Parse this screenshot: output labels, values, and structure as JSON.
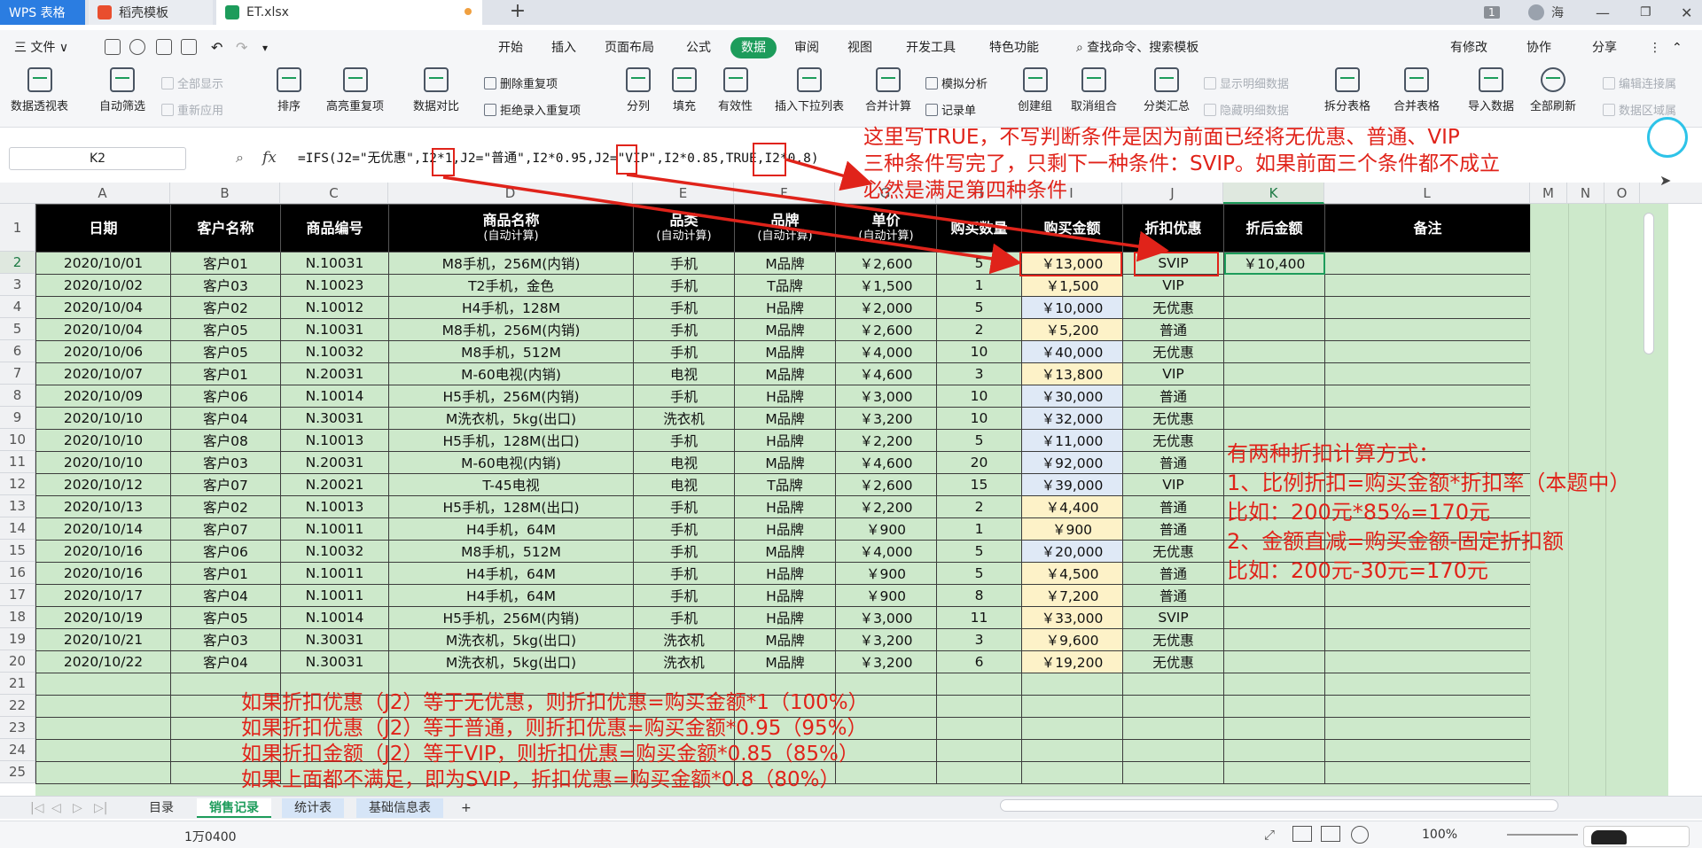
{
  "titlebar": {
    "tabs": [
      {
        "label": "WPS 表格"
      },
      {
        "label": "稻壳模板"
      },
      {
        "label": "ET.xlsx"
      }
    ],
    "plus": "+",
    "window_badge": "1",
    "user": "海"
  },
  "menubar": {
    "file": "三 文件 ∨",
    "items": [
      "开始",
      "插入",
      "页面布局",
      "公式",
      "数据",
      "审阅",
      "视图",
      "开发工具",
      "特色功能"
    ],
    "search": "查找命令、搜索模板",
    "right": [
      "有修改",
      "协作",
      "分享"
    ]
  },
  "ribbon": {
    "big": [
      "数据透视表",
      "自动筛选",
      "排序",
      "高亮重复项",
      "数据对比",
      "分列",
      "填充",
      "有效性",
      "插入下拉列表",
      "合并计算",
      "创建组",
      "取消组合",
      "分类汇总",
      "拆分表格",
      "合并表格",
      "导入数据",
      "全部刷新"
    ],
    "small": {
      "show_all": "全部显示",
      "reapply": "重新应用",
      "delete_dup": "删除重复项",
      "reject_dup": "拒绝录入重复项",
      "simulate": "模拟分析",
      "record": "记录单",
      "show_detail": "显示明细数据",
      "hide_detail": "隐藏明细数据",
      "edit_links": "编辑连接属",
      "data_range": "数据区域属"
    }
  },
  "formulabar": {
    "cell": "K2",
    "fx": "fx",
    "formula": "=IFS(J2=\"无优惠\",I2*1,J2=\"普通\",I2*0.95,J2=\"VIP\",I2*0.85,TRUE,I2*0.8)"
  },
  "columns": [
    "A",
    "B",
    "C",
    "D",
    "E",
    "F",
    "G",
    "H",
    "I",
    "J",
    "K",
    "L",
    "M",
    "N",
    "O"
  ],
  "rows": [
    "1",
    "2",
    "3",
    "4",
    "5",
    "6",
    "7",
    "8",
    "9",
    "10",
    "11",
    "12",
    "13",
    "14",
    "15",
    "16",
    "17",
    "18",
    "19",
    "20",
    "21",
    "22",
    "23",
    "24",
    "25"
  ],
  "table": {
    "headers": [
      {
        "main": "日期",
        "sub": ""
      },
      {
        "main": "客户名称",
        "sub": ""
      },
      {
        "main": "商品编号",
        "sub": ""
      },
      {
        "main": "商品名称",
        "sub": "(自动计算)"
      },
      {
        "main": "品类",
        "sub": "(自动计算)"
      },
      {
        "main": "品牌",
        "sub": "(自动计算)"
      },
      {
        "main": "单价",
        "sub": "(自动计算)"
      },
      {
        "main": "购买数量",
        "sub": ""
      },
      {
        "main": "购买金额",
        "sub": ""
      },
      {
        "main": "折扣优惠",
        "sub": ""
      },
      {
        "main": "折后金额",
        "sub": ""
      },
      {
        "main": "备注",
        "sub": ""
      }
    ],
    "rows": [
      [
        "2020/10/01",
        "客户01",
        "N.10031",
        "M8手机，256M(内销)",
        "手机",
        "M品牌",
        "￥2,600",
        "5",
        "￥13,000",
        "SVIP",
        "￥10,400",
        ""
      ],
      [
        "2020/10/02",
        "客户03",
        "N.10023",
        "T2手机，金色",
        "手机",
        "T品牌",
        "￥1,500",
        "1",
        "￥1,500",
        "VIP",
        "",
        ""
      ],
      [
        "2020/10/04",
        "客户02",
        "N.10012",
        "H4手机，128M",
        "手机",
        "H品牌",
        "￥2,000",
        "5",
        "￥10,000",
        "无优惠",
        "",
        ""
      ],
      [
        "2020/10/04",
        "客户05",
        "N.10031",
        "M8手机，256M(内销)",
        "手机",
        "M品牌",
        "￥2,600",
        "2",
        "￥5,200",
        "普通",
        "",
        ""
      ],
      [
        "2020/10/06",
        "客户05",
        "N.10032",
        "M8手机，512M",
        "手机",
        "M品牌",
        "￥4,000",
        "10",
        "￥40,000",
        "无优惠",
        "",
        ""
      ],
      [
        "2020/10/07",
        "客户01",
        "N.20031",
        "M-60电视(内销)",
        "电视",
        "M品牌",
        "￥4,600",
        "3",
        "￥13,800",
        "VIP",
        "",
        ""
      ],
      [
        "2020/10/09",
        "客户06",
        "N.10014",
        "H5手机，256M(内销)",
        "手机",
        "H品牌",
        "￥3,000",
        "10",
        "￥30,000",
        "普通",
        "",
        ""
      ],
      [
        "2020/10/10",
        "客户04",
        "N.30031",
        "M洗衣机，5kg(出口)",
        "洗衣机",
        "M品牌",
        "￥3,200",
        "10",
        "￥32,000",
        "无优惠",
        "",
        ""
      ],
      [
        "2020/10/10",
        "客户08",
        "N.10013",
        "H5手机，128M(出口)",
        "手机",
        "H品牌",
        "￥2,200",
        "5",
        "￥11,000",
        "无优惠",
        "",
        ""
      ],
      [
        "2020/10/10",
        "客户03",
        "N.20031",
        "M-60电视(内销)",
        "电视",
        "M品牌",
        "￥4,600",
        "20",
        "￥92,000",
        "普通",
        "",
        ""
      ],
      [
        "2020/10/12",
        "客户07",
        "N.20021",
        "T-45电视",
        "电视",
        "T品牌",
        "￥2,600",
        "15",
        "￥39,000",
        "VIP",
        "",
        ""
      ],
      [
        "2020/10/13",
        "客户02",
        "N.10013",
        "H5手机，128M(出口)",
        "手机",
        "H品牌",
        "￥2,200",
        "2",
        "￥4,400",
        "普通",
        "",
        ""
      ],
      [
        "2020/10/14",
        "客户07",
        "N.10011",
        "H4手机，64M",
        "手机",
        "H品牌",
        "￥900",
        "1",
        "￥900",
        "普通",
        "",
        ""
      ],
      [
        "2020/10/16",
        "客户06",
        "N.10032",
        "M8手机，512M",
        "手机",
        "M品牌",
        "￥4,000",
        "5",
        "￥20,000",
        "无优惠",
        "",
        ""
      ],
      [
        "2020/10/16",
        "客户01",
        "N.10011",
        "H4手机，64M",
        "手机",
        "H品牌",
        "￥900",
        "5",
        "￥4,500",
        "普通",
        "",
        ""
      ],
      [
        "2020/10/17",
        "客户04",
        "N.10011",
        "H4手机，64M",
        "手机",
        "H品牌",
        "￥900",
        "8",
        "￥7,200",
        "普通",
        "",
        ""
      ],
      [
        "2020/10/19",
        "客户05",
        "N.10014",
        "H5手机，256M(内销)",
        "手机",
        "H品牌",
        "￥3,000",
        "11",
        "￥33,000",
        "SVIP",
        "",
        ""
      ],
      [
        "2020/10/21",
        "客户03",
        "N.30031",
        "M洗衣机，5kg(出口)",
        "洗衣机",
        "M品牌",
        "￥3,200",
        "3",
        "￥9,600",
        "无优惠",
        "",
        ""
      ],
      [
        "2020/10/22",
        "客户04",
        "N.30031",
        "M洗衣机，5kg(出口)",
        "洗衣机",
        "M品牌",
        "￥3,200",
        "6",
        "￥19,200",
        "无优惠",
        "",
        ""
      ]
    ]
  },
  "notes": {
    "top": [
      "这里写TRUE，不写判断条件是因为前面已经将无优惠、普通、VIP",
      "三种条件写完了，只剩下一种条件：SVIP。如果前面三个条件都不成立",
      "必然是满足第四种条件"
    ],
    "right": [
      "有两种折扣计算方式：",
      "1、比例折扣=购买金额*折扣率（本题中）",
      "比如：200元*85%=170元",
      "2、金额直减=购买金额-固定折扣额",
      "比如：200元-30元=170元"
    ],
    "bottom": [
      "如果折扣优惠（J2）等于无优惠，则折扣优惠=购买金额*1（100%）",
      "如果折扣优惠（J2）等于普通，则折扣优惠=购买金额*0.95（95%）",
      "如果折扣金额（J2）等于VIP，则折扣优惠=购买金额*0.85（85%）",
      "如果上面都不满足，即为SVIP，折扣优惠=购买金额*0.8（80%）"
    ]
  },
  "sheettabs": [
    "目录",
    "销售记录",
    "统计表",
    "基础信息表"
  ],
  "statusbar": {
    "text": "1万0400",
    "zoom": "100%"
  },
  "colors": {
    "accent": "#1d9c5b",
    "annotation": "#e0231a",
    "sheet_bg": "#cde9cb"
  }
}
